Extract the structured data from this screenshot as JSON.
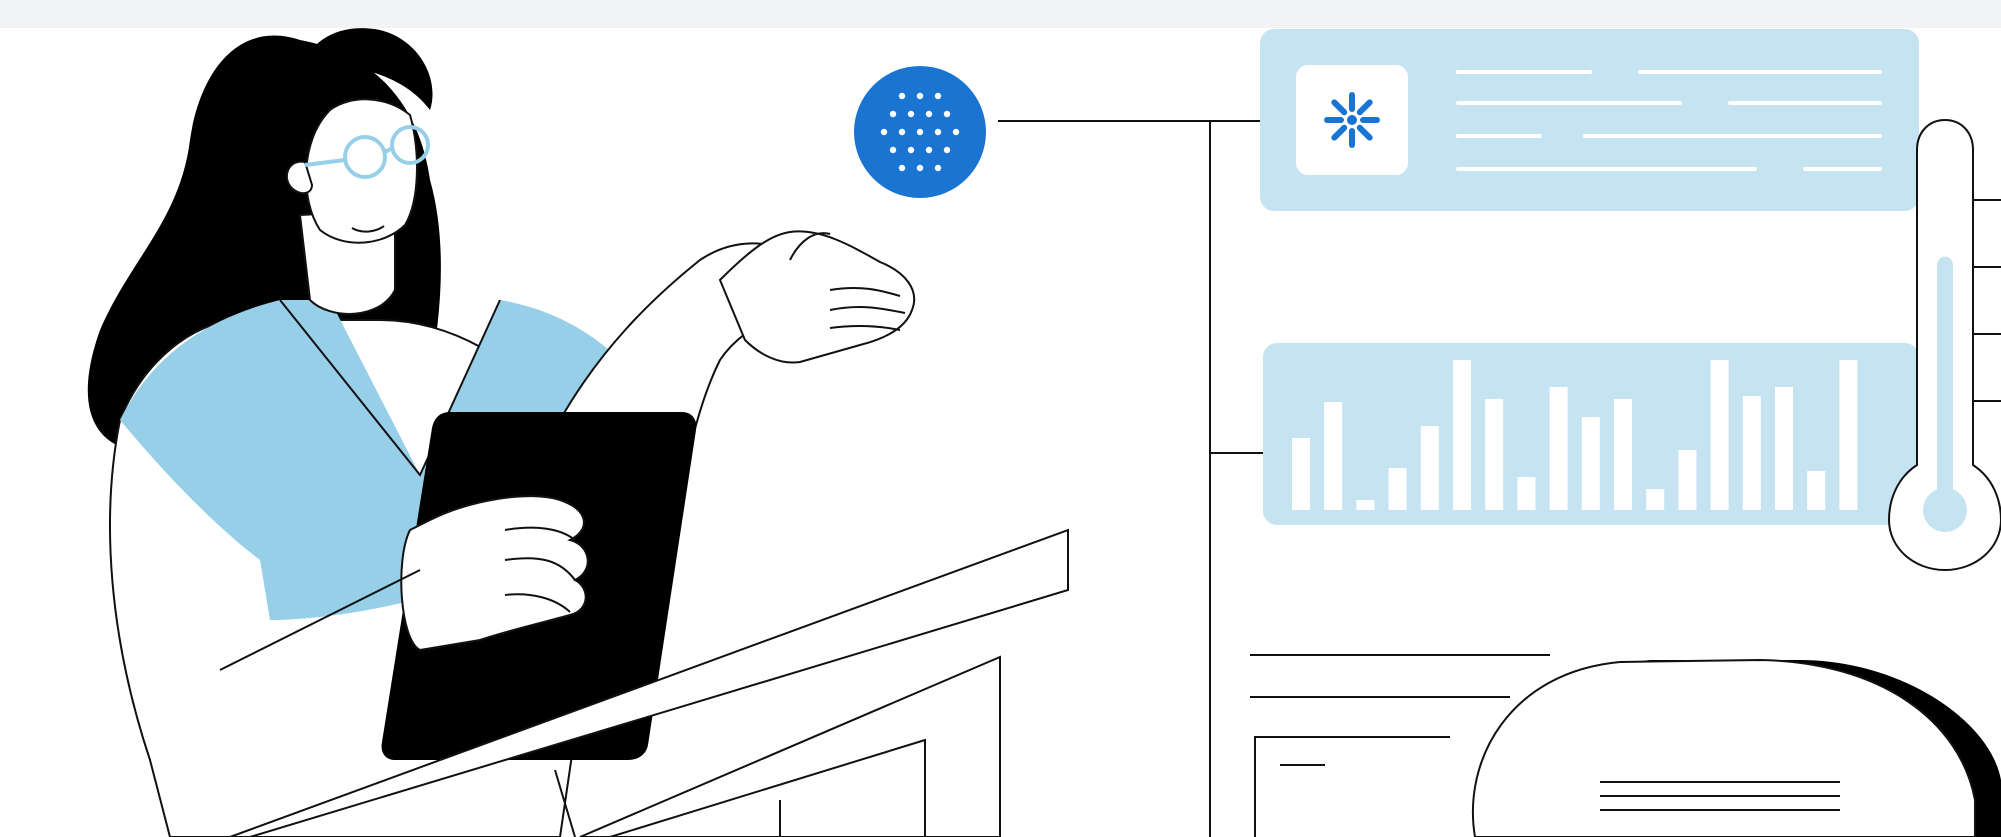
{
  "colors": {
    "background": "#ffffff",
    "top_strip": "#f2f3f5",
    "light_blue": "#c6e3f2",
    "shirt_blue": "#97cfe8",
    "accent_blue": "#1a75d2",
    "line": "#111111",
    "bar_white": "#ffffff"
  },
  "icons": {
    "sensor_chip": "dotted-circle-icon",
    "card_logo": "snowflake-icon",
    "thermometer": "thermometer-icon"
  },
  "illustration": {
    "subject": "person-with-tablet",
    "panels": [
      "info-card",
      "bar-chart-card",
      "document-sheet",
      "round-gauge"
    ]
  },
  "chart_data": {
    "type": "bar",
    "categories": [],
    "values": [
      48,
      72,
      6,
      28,
      56,
      100,
      74,
      22,
      82,
      62,
      74,
      14,
      40,
      100,
      76,
      82,
      26,
      100
    ],
    "title": "",
    "xlabel": "",
    "ylabel": ""
  },
  "thermometer_level": 0.72
}
